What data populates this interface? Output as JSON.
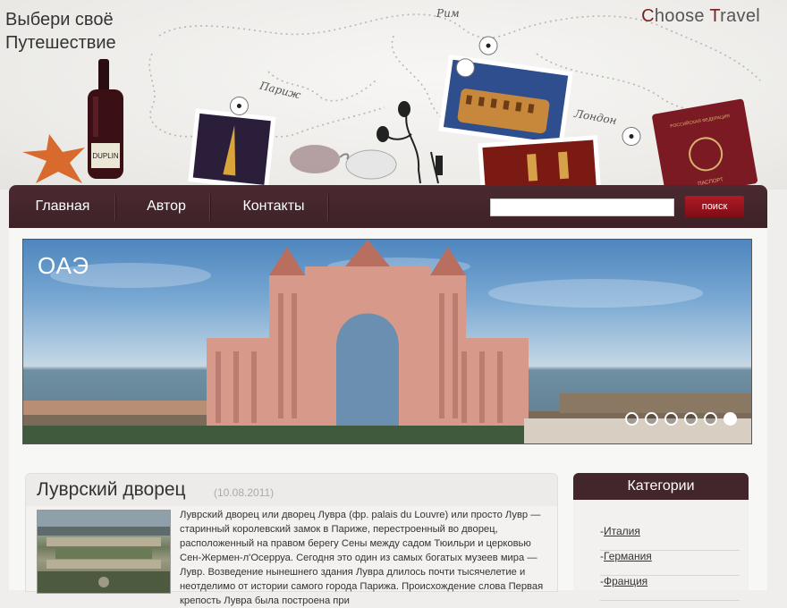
{
  "header": {
    "slogan_line1": "Выбери своё",
    "slogan_line2": "Путешествие",
    "brand_c": "C",
    "brand_hoose": "hoose ",
    "brand_t": "T",
    "brand_ravel": "ravel",
    "cities": {
      "rome": "Рим",
      "paris": "Париж",
      "london": "Лондон"
    },
    "wine_label": "DUPLIN"
  },
  "nav": {
    "items": [
      {
        "label": "Главная"
      },
      {
        "label": "Автор"
      },
      {
        "label": "Контакты"
      }
    ],
    "search_value": "",
    "search_button": "поиск"
  },
  "slider": {
    "caption": "ОАЭ",
    "dot_count": 6,
    "active_dot_index": 5
  },
  "article": {
    "title": "Луврский дворец",
    "date": "(10.08.2011)",
    "text": "Луврский дворец или дворец Лувра (фр. palais du Louvre) или просто Лувр — старинный королевский замок в Париже, перестроенный во дворец, расположенный на правом берегу Сены между садом Тюильри и церковью Сен-Жермен-л'Осерруа. Сегодня это один из самых богатых музеев мира — Лувр. Возведение нынешнего здания Лувра длилось почти тысячелетие и неотделимо от истории самого города Парижа. Происхождение слова Первая крепость Лувра была построена при"
  },
  "sidebar": {
    "title": "Категории",
    "items": [
      {
        "prefix": "-",
        "label": "Италия"
      },
      {
        "prefix": "-",
        "label": "Германия"
      },
      {
        "prefix": "-",
        "label": "Франция"
      }
    ]
  },
  "colors": {
    "nav_bg": "#3d2227",
    "search_button": "#9b1520",
    "brand_accent": "#7c1f1f",
    "sidebar_head": "#43262b"
  },
  "icons": [
    "wine-bottle-icon",
    "starfish-icon",
    "sunglasses-icon",
    "earphones-icon",
    "passport-icon",
    "photo-eiffel-icon",
    "photo-colosseum-icon",
    "photo-london-icon"
  ]
}
